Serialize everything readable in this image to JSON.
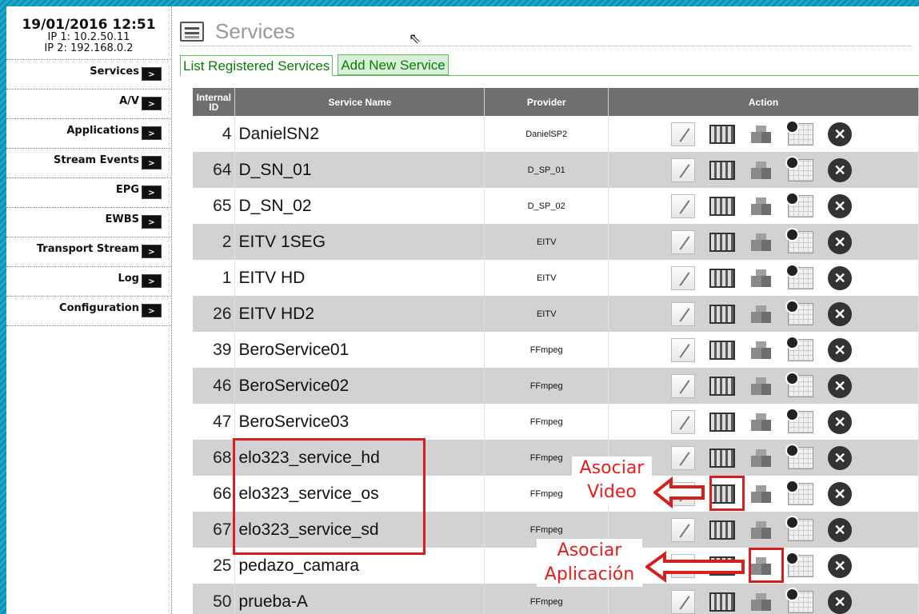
{
  "sidebar": {
    "datetime": "19/01/2016 12:51",
    "ip1": "IP 1: 10.2.50.11",
    "ip2": "IP 2: 192.168.0.2",
    "arrow": ">",
    "items": [
      {
        "label": "Services"
      },
      {
        "label": "A/V"
      },
      {
        "label": "Applications"
      },
      {
        "label": "Stream Events"
      },
      {
        "label": "EPG"
      },
      {
        "label": "EWBS"
      },
      {
        "label": "Transport Stream"
      },
      {
        "label": "Log"
      },
      {
        "label": "Configuration"
      }
    ]
  },
  "header": {
    "title": "Services"
  },
  "tabs": {
    "list": "List Registered Services",
    "add": "Add New Service"
  },
  "table": {
    "headers": {
      "id": "Internal ID",
      "name": "Service Name",
      "provider": "Provider",
      "action": "Action"
    },
    "rows": [
      {
        "id": "4",
        "name": "DanielSN2",
        "provider": "DanielSP2"
      },
      {
        "id": "64",
        "name": "D_SN_01",
        "provider": "D_SP_01"
      },
      {
        "id": "65",
        "name": "D_SN_02",
        "provider": "D_SP_02"
      },
      {
        "id": "2",
        "name": "EITV 1SEG",
        "provider": "EITV"
      },
      {
        "id": "1",
        "name": "EITV HD",
        "provider": "EITV"
      },
      {
        "id": "26",
        "name": "EITV HD2",
        "provider": "EITV"
      },
      {
        "id": "39",
        "name": "BeroService01",
        "provider": "FFmpeg"
      },
      {
        "id": "46",
        "name": "BeroService02",
        "provider": "FFmpeg"
      },
      {
        "id": "47",
        "name": "BeroService03",
        "provider": "FFmpeg"
      },
      {
        "id": "68",
        "name": "elo323_service_hd",
        "provider": "FFmpeg"
      },
      {
        "id": "66",
        "name": "elo323_service_os",
        "provider": "FFmpeg"
      },
      {
        "id": "67",
        "name": "elo323_service_sd",
        "provider": "FFmpeg"
      },
      {
        "id": "25",
        "name": "pedazo_camara",
        "provider": ""
      },
      {
        "id": "50",
        "name": "prueba-A",
        "provider": "FFmpeg"
      }
    ],
    "delete_glyph": "✕"
  },
  "annotations": {
    "video_line1": "Asociar",
    "video_line2": "Video",
    "app_line1": "Asociar",
    "app_line2": "Aplicación",
    "color": "#d32020"
  },
  "colors": {
    "frame": "#17a0c4",
    "tab_green": "#0a7a0a",
    "header_gray": "#6f6f6f"
  }
}
